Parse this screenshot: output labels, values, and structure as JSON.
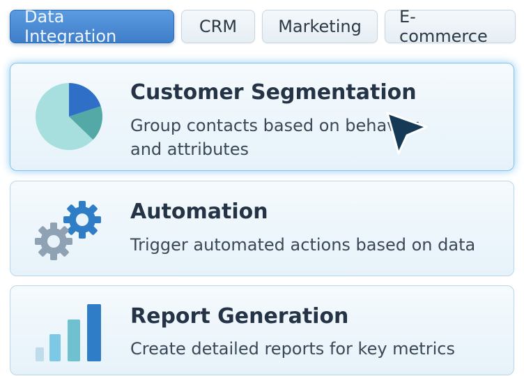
{
  "tabs": [
    {
      "label": "Data Integration",
      "active": true
    },
    {
      "label": "CRM",
      "active": false
    },
    {
      "label": "Marketing",
      "active": false
    },
    {
      "label": "E-commerce",
      "active": false
    }
  ],
  "cards": [
    {
      "title": "Customer Segmentation",
      "description": "Group contacts based on behavior\nand attributes",
      "icon": "pie-chart-icon",
      "selected": true
    },
    {
      "title": "Automation",
      "description": "Trigger automated actions based on data",
      "icon": "gears-icon",
      "selected": false
    },
    {
      "title": "Report Generation",
      "description": "Create detailed reports for key metrics",
      "icon": "bar-chart-icon",
      "selected": false
    }
  ],
  "colors": {
    "accent": "#3f7ec9",
    "card_border": "#b9d6ea",
    "title_text": "#243446",
    "cursor": "#163a55"
  },
  "cursor_icon": "mouse-pointer-icon"
}
